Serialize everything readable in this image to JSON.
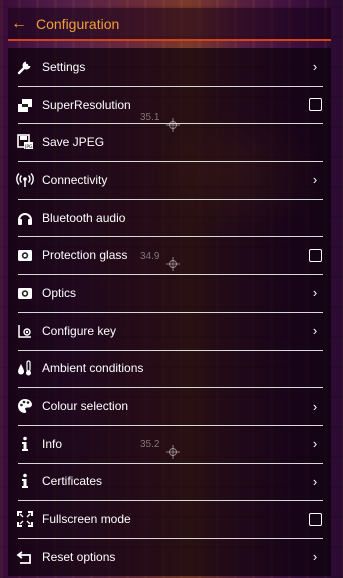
{
  "header": {
    "back_glyph": "←",
    "title": "Configuration"
  },
  "menu": {
    "items": [
      {
        "label": "Settings",
        "icon": "wrench-icon",
        "control": "chevron"
      },
      {
        "label": "SuperResolution",
        "icon": "superresolution-icon",
        "control": "checkbox",
        "checked": false
      },
      {
        "label": "Save JPEG",
        "icon": "save-jpeg-icon",
        "control": "none"
      },
      {
        "label": "Connectivity",
        "icon": "wireless-icon",
        "control": "chevron"
      },
      {
        "label": "Bluetooth audio",
        "icon": "headphones-icon",
        "control": "none"
      },
      {
        "label": "Protection glass",
        "icon": "camera-icon",
        "control": "checkbox",
        "checked": false
      },
      {
        "label": "Optics",
        "icon": "camera-icon",
        "control": "chevron"
      },
      {
        "label": "Configure key",
        "icon": "configure-key-icon",
        "control": "chevron"
      },
      {
        "label": "Ambient conditions",
        "icon": "humidity-thermometer-icon",
        "control": "none"
      },
      {
        "label": "Colour selection",
        "icon": "palette-icon",
        "control": "chevron"
      },
      {
        "label": "Info",
        "icon": "info-icon",
        "control": "chevron"
      },
      {
        "label": "Certificates",
        "icon": "info-icon",
        "control": "chevron"
      },
      {
        "label": "Fullscreen mode",
        "icon": "fullscreen-icon",
        "control": "checkbox",
        "checked": false
      },
      {
        "label": "Reset options",
        "icon": "reset-icon",
        "control": "chevron"
      }
    ]
  },
  "overlay_temperatures": [
    "35.1",
    "34.9",
    "35.2"
  ],
  "colors": {
    "accent": "#f0a038",
    "header_line": "#d4441c",
    "divider": "#d8d8d8",
    "text": "#ffffff"
  }
}
